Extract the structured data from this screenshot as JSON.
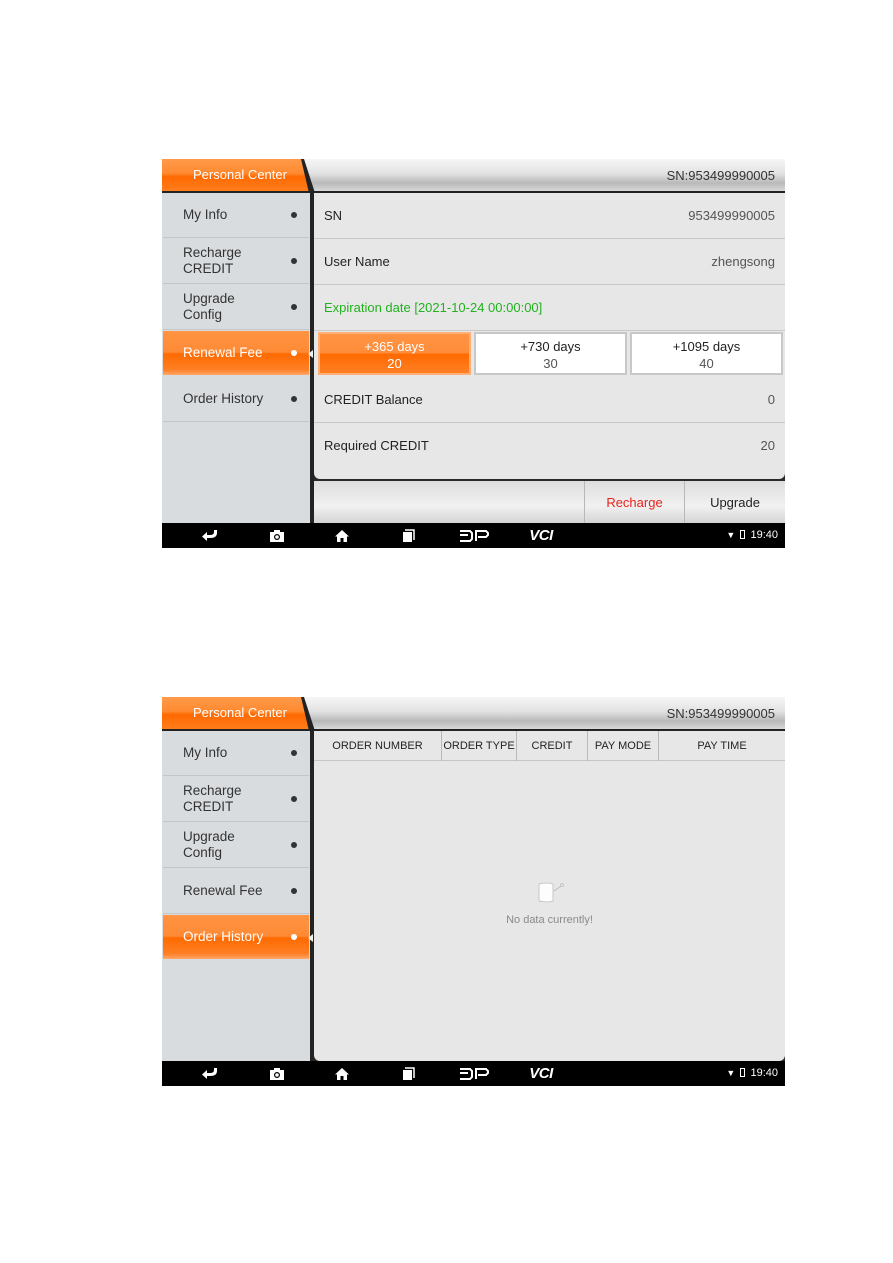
{
  "screens": [
    {
      "title": "Personal Center",
      "sn_header": "SN:953499990005",
      "sidebar": [
        {
          "label": "My Info",
          "active": false
        },
        {
          "label": "Recharge\nCREDIT",
          "active": false
        },
        {
          "label": "Upgrade\nConfig",
          "active": false
        },
        {
          "label": "Renewal Fee",
          "active": true
        },
        {
          "label": "Order History",
          "active": false
        }
      ],
      "content": {
        "sn_label": "SN",
        "sn_value": "953499990005",
        "username_label": "User Name",
        "username_value": "zhengsong",
        "expiration": "Expiration date [2021-10-24 00:00:00]",
        "options": [
          {
            "days": "+365 days",
            "credit": "20",
            "selected": true
          },
          {
            "days": "+730 days",
            "credit": "30",
            "selected": false
          },
          {
            "days": "+1095 days",
            "credit": "40",
            "selected": false
          }
        ],
        "balance_label": "CREDIT Balance",
        "balance_value": "0",
        "required_label": "Required CREDIT",
        "required_value": "20"
      },
      "footer": {
        "recharge": "Recharge",
        "upgrade": "Upgrade"
      },
      "navbar": {
        "icons": [
          "back-icon",
          "camera-icon",
          "home-icon",
          "recent-apps-icon",
          "dp-icon",
          "vci-icon"
        ],
        "dp_label": "DP",
        "vci_label": "VCI",
        "time": "19:40"
      }
    },
    {
      "title": "Personal Center",
      "sn_header": "SN:953499990005",
      "sidebar": [
        {
          "label": "My Info",
          "active": false
        },
        {
          "label": "Recharge\nCREDIT",
          "active": false
        },
        {
          "label": "Upgrade\nConfig",
          "active": false
        },
        {
          "label": "Renewal Fee",
          "active": false
        },
        {
          "label": "Order History",
          "active": true
        }
      ],
      "table": {
        "columns": [
          "ORDER NUMBER",
          "ORDER TYPE",
          "CREDIT",
          "PAY MODE",
          "PAY TIME"
        ],
        "rows": [],
        "empty_text": "No data currently!"
      },
      "navbar": {
        "icons": [
          "back-icon",
          "camera-icon",
          "home-icon",
          "recent-apps-icon",
          "dp-icon",
          "vci-icon"
        ],
        "dp_label": "DP",
        "vci_label": "VCI",
        "time": "19:40"
      }
    }
  ],
  "colors": {
    "accent_orange": "#ff6a00",
    "expiration_green": "#22b21e",
    "recharge_red": "#e8231c"
  }
}
